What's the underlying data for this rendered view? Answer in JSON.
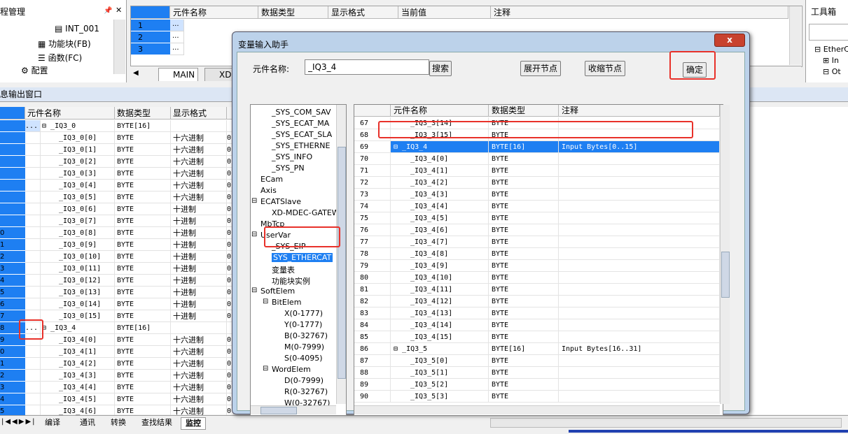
{
  "project_panel": {
    "title": "程管理",
    "items": [
      "INT_001",
      "功能块(FB)",
      "函数(FC)",
      "配置"
    ]
  },
  "top_grid": {
    "headers": [
      "元件名称",
      "数据类型",
      "显示格式",
      "当前值",
      "注释"
    ],
    "rows": [
      {
        "idx": "1",
        "name": "..."
      },
      {
        "idx": "2",
        "name": "..."
      },
      {
        "idx": "3",
        "name": "..."
      }
    ],
    "tabs": [
      "MAIN",
      "XD"
    ]
  },
  "toolbox": {
    "title": "工具箱",
    "items": [
      "EtherC",
      "In",
      "Ot"
    ]
  },
  "output_window": {
    "title": "息输出窗口",
    "headers": [
      "元件名称",
      "数据类型",
      "显示格式"
    ],
    "rows": [
      {
        "idx": "",
        "name": "_IQ3_0",
        "type": "BYTE[16]",
        "fmt": "",
        "group": true,
        "dots": "..."
      },
      {
        "idx": "",
        "name": "_IQ3_0[0]",
        "type": "BYTE",
        "fmt": "十六进制",
        "extra": "0"
      },
      {
        "idx": "",
        "name": "_IQ3_0[1]",
        "type": "BYTE",
        "fmt": "十六进制",
        "extra": "0"
      },
      {
        "idx": "",
        "name": "_IQ3_0[2]",
        "type": "BYTE",
        "fmt": "十六进制",
        "extra": "0"
      },
      {
        "idx": "",
        "name": "_IQ3_0[3]",
        "type": "BYTE",
        "fmt": "十六进制",
        "extra": "0"
      },
      {
        "idx": "",
        "name": "_IQ3_0[4]",
        "type": "BYTE",
        "fmt": "十六进制",
        "extra": "0"
      },
      {
        "idx": "",
        "name": "_IQ3_0[5]",
        "type": "BYTE",
        "fmt": "十六进制",
        "extra": "0"
      },
      {
        "idx": "",
        "name": "_IQ3_0[6]",
        "type": "BYTE",
        "fmt": "十进制",
        "extra": "0"
      },
      {
        "idx": "",
        "name": "_IQ3_0[7]",
        "type": "BYTE",
        "fmt": "十进制",
        "extra": "0"
      },
      {
        "idx": "0",
        "name": "_IQ3_0[8]",
        "type": "BYTE",
        "fmt": "十进制",
        "extra": "0"
      },
      {
        "idx": "1",
        "name": "_IQ3_0[9]",
        "type": "BYTE",
        "fmt": "十进制",
        "extra": "0"
      },
      {
        "idx": "2",
        "name": "_IQ3_0[10]",
        "type": "BYTE",
        "fmt": "十进制",
        "extra": "0"
      },
      {
        "idx": "3",
        "name": "_IQ3_0[11]",
        "type": "BYTE",
        "fmt": "十进制",
        "extra": "0"
      },
      {
        "idx": "4",
        "name": "_IQ3_0[12]",
        "type": "BYTE",
        "fmt": "十进制",
        "extra": "0"
      },
      {
        "idx": "5",
        "name": "_IQ3_0[13]",
        "type": "BYTE",
        "fmt": "十进制",
        "extra": "0"
      },
      {
        "idx": "6",
        "name": "_IQ3_0[14]",
        "type": "BYTE",
        "fmt": "十进制",
        "extra": "0"
      },
      {
        "idx": "7",
        "name": "_IQ3_0[15]",
        "type": "BYTE",
        "fmt": "十进制",
        "extra": "0"
      },
      {
        "idx": "8",
        "name": "_IQ3_4",
        "type": "BYTE[16]",
        "fmt": "",
        "group": true,
        "dots": "..."
      },
      {
        "idx": "9",
        "name": "_IQ3_4[0]",
        "type": "BYTE",
        "fmt": "十六进制",
        "extra": "0"
      },
      {
        "idx": "0",
        "name": "_IQ3_4[1]",
        "type": "BYTE",
        "fmt": "十六进制",
        "extra": "0"
      },
      {
        "idx": "1",
        "name": "_IQ3_4[2]",
        "type": "BYTE",
        "fmt": "十六进制",
        "extra": "0"
      },
      {
        "idx": "2",
        "name": "_IQ3_4[3]",
        "type": "BYTE",
        "fmt": "十六进制",
        "extra": "0"
      },
      {
        "idx": "3",
        "name": "_IQ3_4[4]",
        "type": "BYTE",
        "fmt": "十六进制",
        "extra": "0"
      },
      {
        "idx": "4",
        "name": "_IQ3_4[5]",
        "type": "BYTE",
        "fmt": "十六进制",
        "extra": "0"
      },
      {
        "idx": "5",
        "name": "_IQ3_4[6]",
        "type": "BYTE",
        "fmt": "十六进制",
        "extra": "0"
      }
    ]
  },
  "bottom_tabs": [
    "编译",
    "通讯",
    "转换",
    "查找结果",
    "监控"
  ],
  "dialog": {
    "title": "变量输入助手",
    "close_label": "x",
    "element_name_label": "元件名称:",
    "element_name_value": "_IQ3_4",
    "search_btn": "搜索",
    "expand_btn": "展开节点",
    "collapse_btn": "收缩节点",
    "ok_btn": "确定",
    "tree": [
      {
        "label": "_SYS_COM_SAV",
        "level": 2
      },
      {
        "label": "_SYS_ECAT_MA",
        "level": 2
      },
      {
        "label": "_SYS_ECAT_SLA",
        "level": 2
      },
      {
        "label": "_SYS_ETHERNE",
        "level": 2
      },
      {
        "label": "_SYS_INFO",
        "level": 2
      },
      {
        "label": "_SYS_PN",
        "level": 2
      },
      {
        "label": "ECam",
        "level": 1
      },
      {
        "label": "Axis",
        "level": 1
      },
      {
        "label": "ECATSlave",
        "level": 1,
        "expanded": true
      },
      {
        "label": "XD-MDEC-GATEW",
        "level": 2
      },
      {
        "label": "MbTcp",
        "level": 1
      },
      {
        "label": "UserVar",
        "level": 1,
        "expanded": true
      },
      {
        "label": "_SYS_EIP",
        "level": 2
      },
      {
        "label": "SYS_ETHERCAT",
        "level": 2,
        "selected": true
      },
      {
        "label": "变量表",
        "level": 2
      },
      {
        "label": "功能块实例",
        "level": 2
      },
      {
        "label": "SoftElem",
        "level": 1,
        "expanded": true
      },
      {
        "label": "BitElem",
        "level": 2,
        "expanded": true
      },
      {
        "label": "X(0-1777)",
        "level": 3
      },
      {
        "label": "Y(0-1777)",
        "level": 3
      },
      {
        "label": "B(0-32767)",
        "level": 3
      },
      {
        "label": "M(0-7999)",
        "level": 3
      },
      {
        "label": "S(0-4095)",
        "level": 3
      },
      {
        "label": "WordElem",
        "level": 2,
        "expanded": true
      },
      {
        "label": "D(0-7999)",
        "level": 3
      },
      {
        "label": "R(0-32767)",
        "level": 3
      },
      {
        "label": "W(0-32767)",
        "level": 3
      }
    ],
    "grid_headers": [
      "元件名称",
      "数据类型",
      "注释"
    ],
    "grid_rows": [
      {
        "idx": "67",
        "name": "_IQ3_3[14]",
        "type": "BYTE",
        "note": ""
      },
      {
        "idx": "68",
        "name": "_IQ3_3[15]",
        "type": "BYTE",
        "note": ""
      },
      {
        "idx": "69",
        "name": "_IQ3_4",
        "type": "BYTE[16]",
        "note": "Input Bytes[0..15]",
        "group": true,
        "selected": true
      },
      {
        "idx": "70",
        "name": "_IQ3_4[0]",
        "type": "BYTE",
        "note": ""
      },
      {
        "idx": "71",
        "name": "_IQ3_4[1]",
        "type": "BYTE",
        "note": ""
      },
      {
        "idx": "72",
        "name": "_IQ3_4[2]",
        "type": "BYTE",
        "note": ""
      },
      {
        "idx": "73",
        "name": "_IQ3_4[3]",
        "type": "BYTE",
        "note": ""
      },
      {
        "idx": "74",
        "name": "_IQ3_4[4]",
        "type": "BYTE",
        "note": ""
      },
      {
        "idx": "75",
        "name": "_IQ3_4[5]",
        "type": "BYTE",
        "note": ""
      },
      {
        "idx": "76",
        "name": "_IQ3_4[6]",
        "type": "BYTE",
        "note": ""
      },
      {
        "idx": "77",
        "name": "_IQ3_4[7]",
        "type": "BYTE",
        "note": ""
      },
      {
        "idx": "78",
        "name": "_IQ3_4[8]",
        "type": "BYTE",
        "note": ""
      },
      {
        "idx": "79",
        "name": "_IQ3_4[9]",
        "type": "BYTE",
        "note": ""
      },
      {
        "idx": "80",
        "name": "_IQ3_4[10]",
        "type": "BYTE",
        "note": ""
      },
      {
        "idx": "81",
        "name": "_IQ3_4[11]",
        "type": "BYTE",
        "note": ""
      },
      {
        "idx": "82",
        "name": "_IQ3_4[12]",
        "type": "BYTE",
        "note": ""
      },
      {
        "idx": "83",
        "name": "_IQ3_4[13]",
        "type": "BYTE",
        "note": ""
      },
      {
        "idx": "84",
        "name": "_IQ3_4[14]",
        "type": "BYTE",
        "note": ""
      },
      {
        "idx": "85",
        "name": "_IQ3_4[15]",
        "type": "BYTE",
        "note": ""
      },
      {
        "idx": "86",
        "name": "_IQ3_5",
        "type": "BYTE[16]",
        "note": "Input Bytes[16..31]",
        "group": true
      },
      {
        "idx": "87",
        "name": "_IQ3_5[0]",
        "type": "BYTE",
        "note": ""
      },
      {
        "idx": "88",
        "name": "_IQ3_5[1]",
        "type": "BYTE",
        "note": ""
      },
      {
        "idx": "89",
        "name": "_IQ3_5[2]",
        "type": "BYTE",
        "note": ""
      },
      {
        "idx": "90",
        "name": "_IQ3_5[3]",
        "type": "BYTE",
        "note": ""
      }
    ]
  },
  "colors": {
    "selection_blue": "#1e7ff2",
    "highlight_red": "#e8312a",
    "dialog_frame": "#bcd2ea"
  }
}
